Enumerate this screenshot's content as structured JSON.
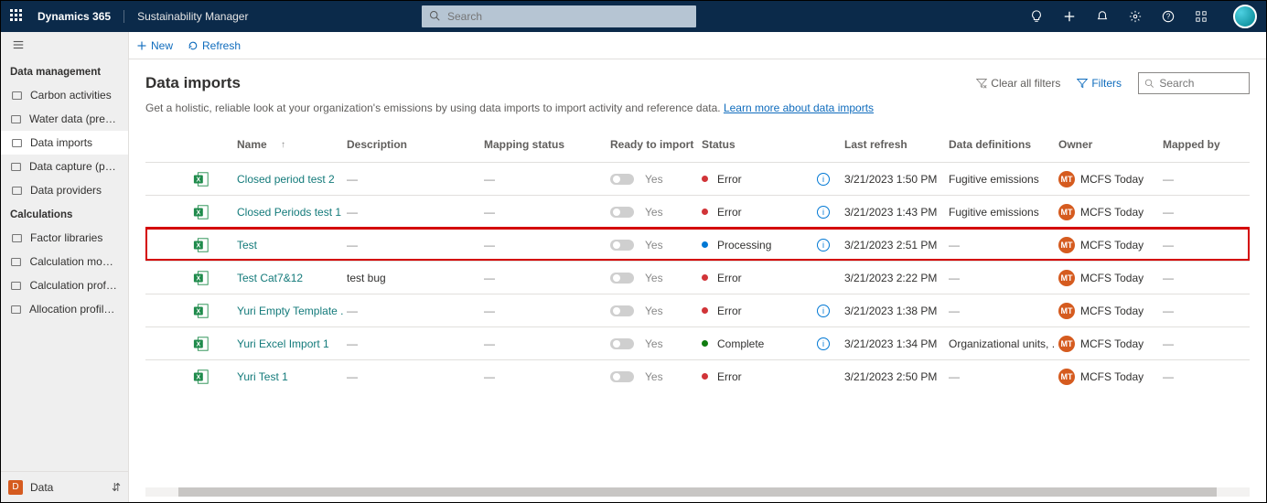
{
  "topbar": {
    "brand": "Dynamics 365",
    "suite": "Sustainability Manager",
    "search_placeholder": "Search"
  },
  "sidebar": {
    "section1": {
      "heading": "Data management",
      "items": [
        {
          "label": "Carbon activities"
        },
        {
          "label": "Water data (preview)"
        },
        {
          "label": "Data imports"
        },
        {
          "label": "Data capture (preview)"
        },
        {
          "label": "Data providers"
        }
      ]
    },
    "section2": {
      "heading": "Calculations",
      "items": [
        {
          "label": "Factor libraries"
        },
        {
          "label": "Calculation models"
        },
        {
          "label": "Calculation profiles"
        },
        {
          "label": "Allocation profiles (p..."
        }
      ]
    },
    "footer": {
      "label": "Data",
      "initial": "D"
    }
  },
  "commandbar": {
    "new": "New",
    "refresh": "Refresh"
  },
  "page": {
    "title": "Data imports",
    "subcopy": "Get a holistic, reliable look at your organization's emissions by using data imports to import activity and reference data. ",
    "learn": "Learn more about data imports",
    "clear_filters": "Clear all filters",
    "filters": "Filters",
    "search_placeholder": "Search"
  },
  "grid": {
    "columns": {
      "name": "Name",
      "sort": "↑",
      "description": "Description",
      "mapping": "Mapping status",
      "ready": "Ready to import",
      "status": "Status",
      "lastrefresh": "Last refresh",
      "datadef": "Data definitions",
      "owner": "Owner",
      "mappedby": "Mapped by"
    },
    "ready_text": "Yes",
    "owner_label": "MCFS Today",
    "owner_initials": "MT",
    "rows": [
      {
        "name": "Closed period test 2",
        "description": "---",
        "mapping": "---",
        "status": "Error",
        "statusclass": "st-red",
        "info": true,
        "lastrefresh": "3/21/2023 1:50 PM",
        "datadef": "Fugitive emissions",
        "mappedby": "---",
        "highlight": false
      },
      {
        "name": "Closed Periods test 1",
        "description": "---",
        "mapping": "---",
        "status": "Error",
        "statusclass": "st-red",
        "info": true,
        "lastrefresh": "3/21/2023 1:43 PM",
        "datadef": "Fugitive emissions",
        "mappedby": "---",
        "highlight": false
      },
      {
        "name": "Test",
        "description": "---",
        "mapping": "---",
        "status": "Processing",
        "statusclass": "st-blue",
        "info": true,
        "lastrefresh": "3/21/2023 2:51 PM",
        "datadef": "---",
        "mappedby": "---",
        "highlight": true
      },
      {
        "name": "Test Cat7&12",
        "description": "test bug",
        "mapping": "---",
        "status": "Error",
        "statusclass": "st-red",
        "info": false,
        "lastrefresh": "3/21/2023 2:22 PM",
        "datadef": "---",
        "mappedby": "---",
        "highlight": false
      },
      {
        "name": "Yuri Empty Template ...",
        "description": "---",
        "mapping": "---",
        "status": "Error",
        "statusclass": "st-red",
        "info": true,
        "lastrefresh": "3/21/2023 1:38 PM",
        "datadef": "---",
        "mappedby": "---",
        "highlight": false
      },
      {
        "name": "Yuri Excel Import 1",
        "description": "---",
        "mapping": "---",
        "status": "Complete",
        "statusclass": "st-green",
        "info": true,
        "lastrefresh": "3/21/2023 1:34 PM",
        "datadef": "Organizational units, ...",
        "mappedby": "---",
        "highlight": false
      },
      {
        "name": "Yuri Test 1",
        "description": "---",
        "mapping": "---",
        "status": "Error",
        "statusclass": "st-red",
        "info": false,
        "lastrefresh": "3/21/2023 2:50 PM",
        "datadef": "---",
        "mappedby": "---",
        "highlight": false
      }
    ]
  }
}
